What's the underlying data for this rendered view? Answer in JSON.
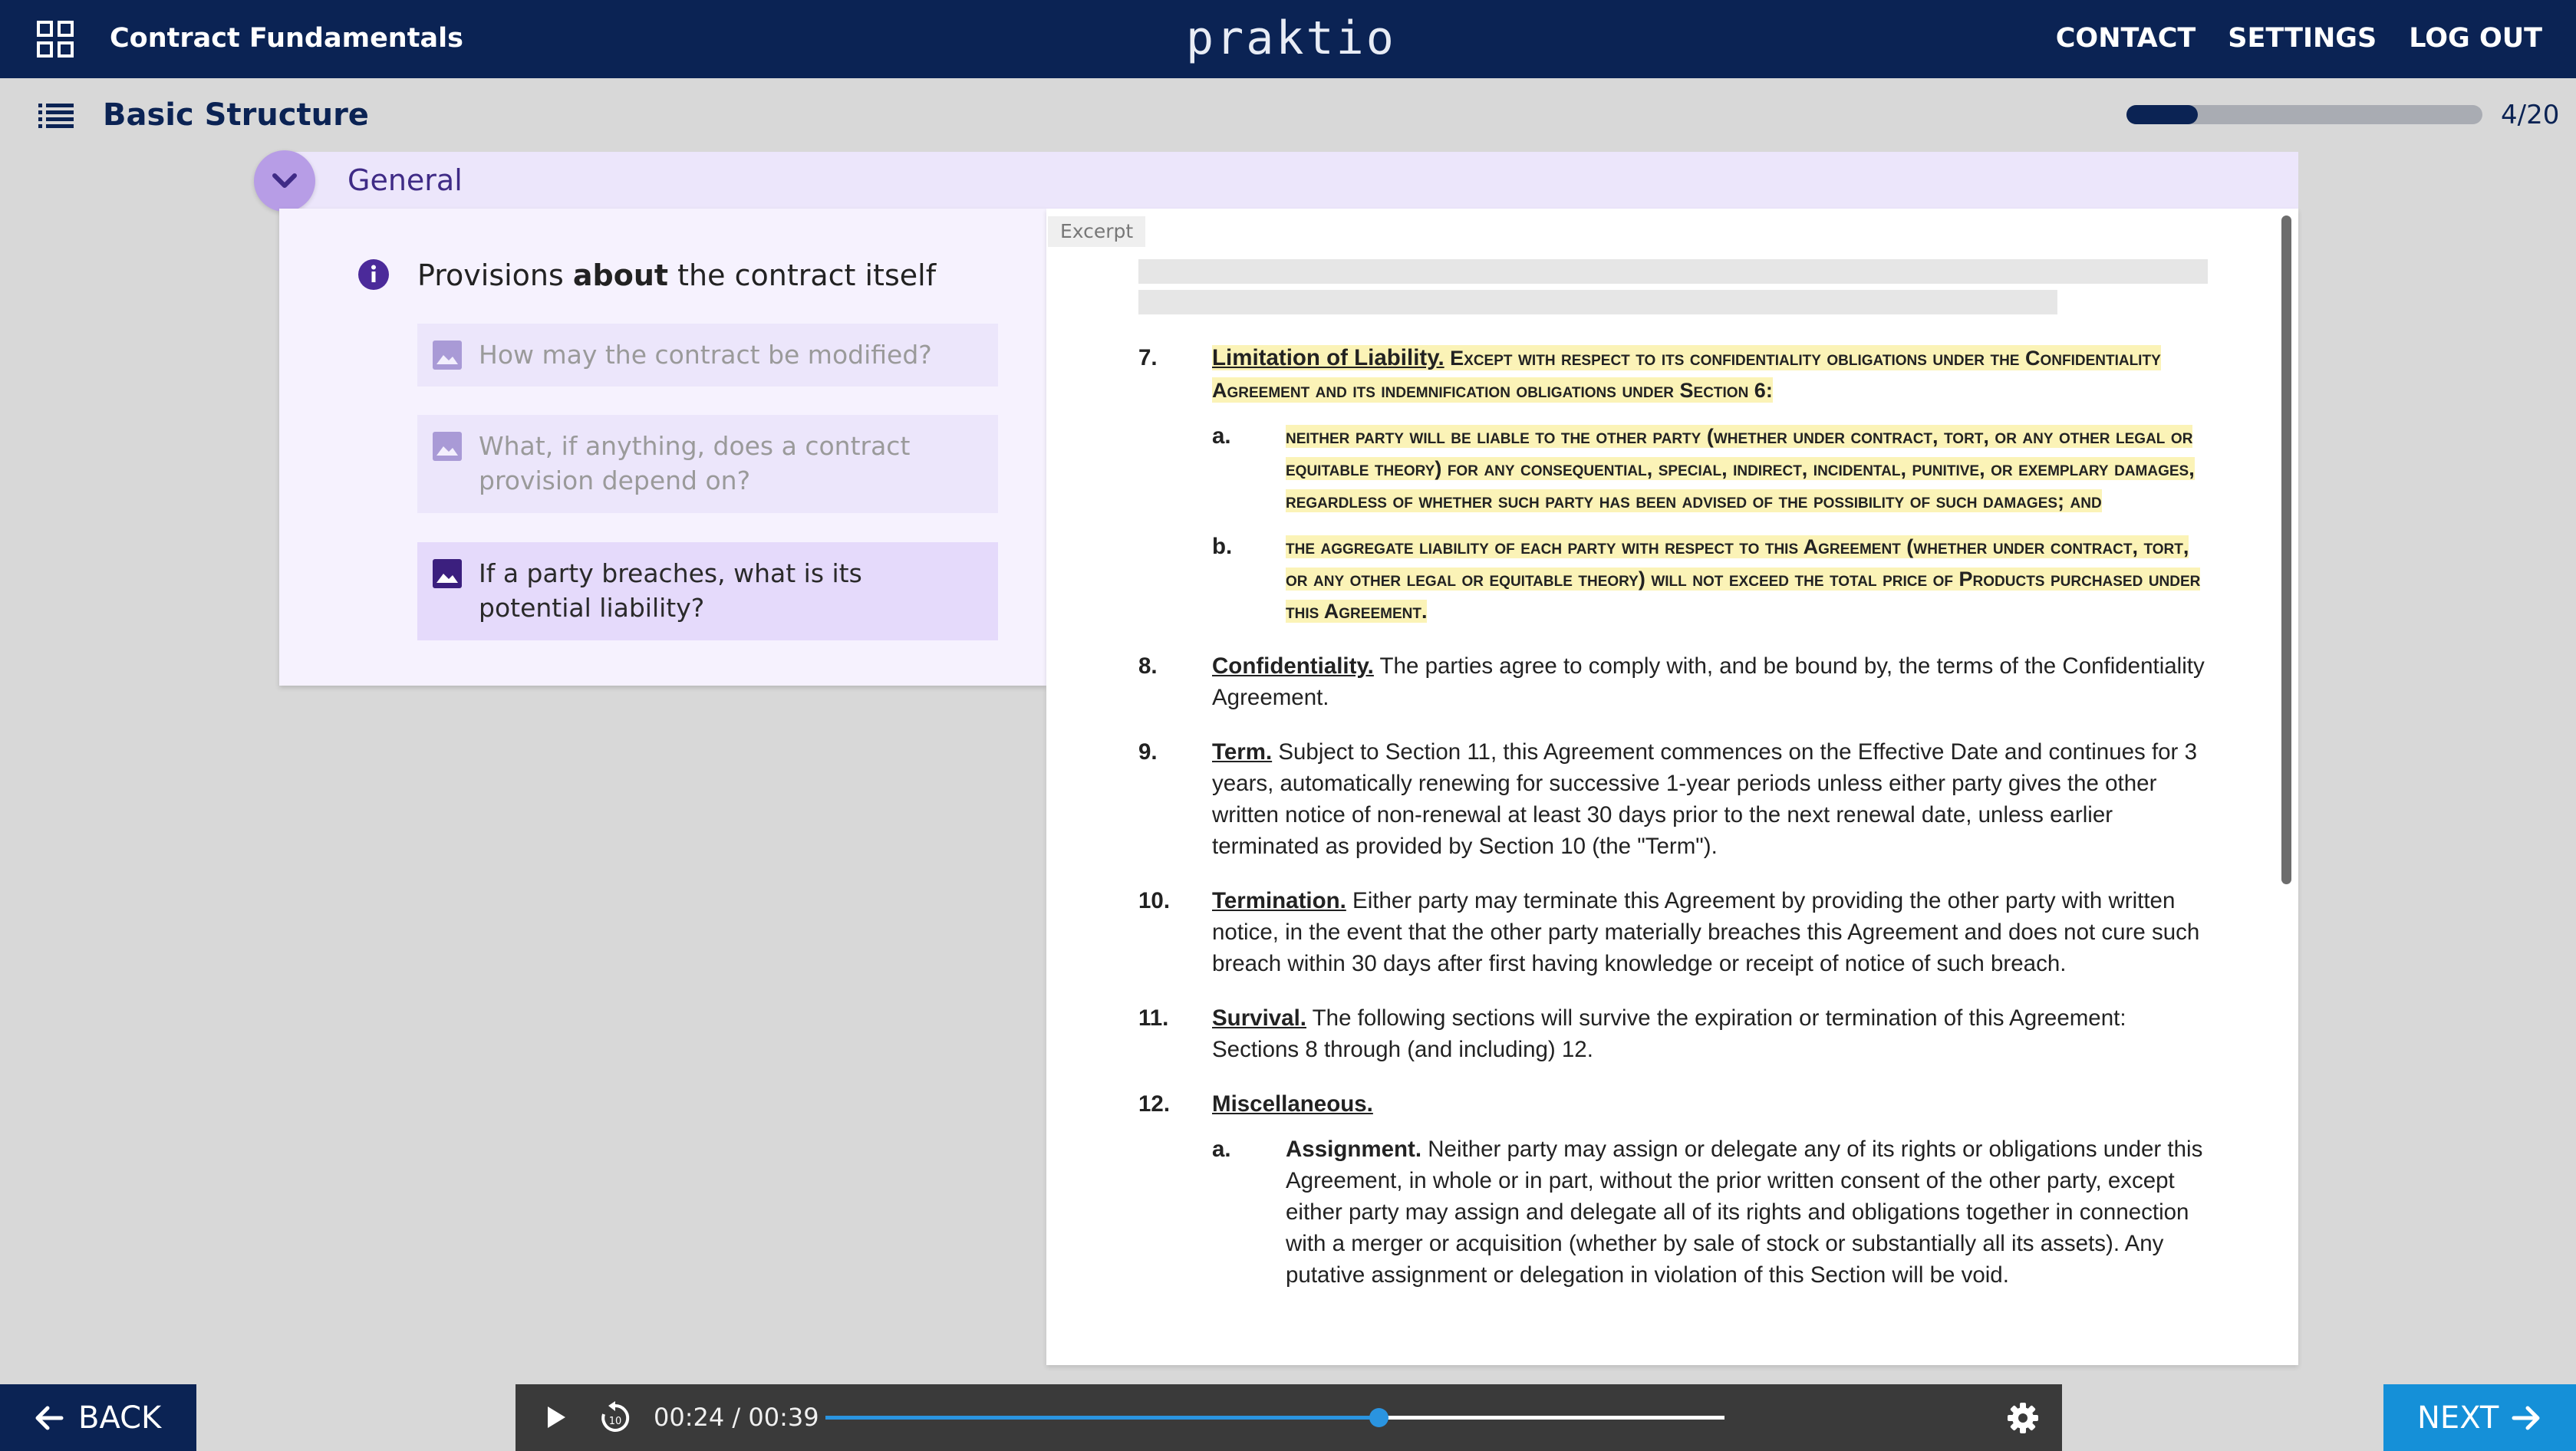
{
  "header": {
    "course_title": "Contract Fundamentals",
    "brand": "praktio",
    "nav": [
      "CONTACT",
      "SETTINGS",
      "LOG OUT"
    ]
  },
  "subheader": {
    "section_title": "Basic Structure",
    "progress_text": "4/20",
    "progress_fraction": 0.2
  },
  "panel": {
    "label": "General",
    "provisions_prefix": "Provisions ",
    "provisions_bold": "about",
    "provisions_suffix": " the contract itself",
    "questions": [
      "How may the contract be modified?",
      "What, if anything, does a contract provision depend on?",
      "If a party breaches, what is its potential liability?"
    ]
  },
  "document": {
    "excerpt_label": "Excerpt",
    "clauses": [
      {
        "num": "7.",
        "title": "Limitation of Liability.",
        "text": " Except with respect to its confidentiality obligations under the Confidentiality Agreement and its indemnification obligations under Section 6:",
        "subs": [
          {
            "num": "a.",
            "text": "neither party will be liable to the other party (whether under contract, tort, or any other legal or equitable theory) for any consequential, special, indirect, incidental, punitive, or exemplary damages, regardless of whether such party has been advised of the possibility of such damages; and"
          },
          {
            "num": "b.",
            "text": "the aggregate liability of each party with respect to this Agreement (whether under contract, tort, or any other legal or equitable theory) will not exceed the total price of Products purchased under this Agreement."
          }
        ]
      },
      {
        "num": "8.",
        "title": "Confidentiality.",
        "text": " The parties agree to comply with, and be bound by, the terms of the Confidentiality Agreement."
      },
      {
        "num": "9.",
        "title": "Term.",
        "text": " Subject to Section 11, this Agreement commences on the Effective Date and continues for 3 years, automatically renewing for successive 1-year periods unless either party gives the other written notice of non-renewal at least 30 days prior to the next renewal date, unless earlier terminated as provided by Section 10 (the \"Term\")."
      },
      {
        "num": "10.",
        "title": "Termination.",
        "text": " Either party may terminate this Agreement by providing the other party with written notice, in the event that the other party materially breaches this Agreement and does not cure such breach within 30 days after first having knowledge or receipt of notice of such breach."
      },
      {
        "num": "11.",
        "title": "Survival.",
        "text": " The following sections will survive the expiration or termination of this Agreement: Sections 8 through (and including) 12."
      },
      {
        "num": "12.",
        "title": "Miscellaneous.",
        "text": "",
        "subs": [
          {
            "num": "a.",
            "bold": "Assignment.",
            "text": " Neither party may assign or delegate any of its rights or obligations under this Agreement, in whole or in part, without the prior written consent of the other party, except either party may assign and delegate all of its rights and obligations together in connection with a merger or acquisition (whether by sale of stock or substantially all its assets). Any putative assignment or delegation in violation of this Section will be void."
          }
        ]
      }
    ]
  },
  "footer": {
    "back_label": "BACK",
    "next_label": "NEXT",
    "player": {
      "time": "00:24 / 00:39",
      "progress_fraction": 0.6154
    }
  },
  "icons": [
    "grid-icon",
    "list-icon",
    "chevron-down-icon",
    "info-icon",
    "image-icon",
    "arrow-left-icon",
    "arrow-right-icon",
    "play-icon",
    "replay-10-icon",
    "gear-icon"
  ],
  "colors": {
    "navy": "#0b2354",
    "lavender": "#ece6fb",
    "accent_purple": "#3f2b86",
    "highlight": "#fbf3b7",
    "next_blue": "#1590d8",
    "player_blue": "#2a94e0"
  }
}
